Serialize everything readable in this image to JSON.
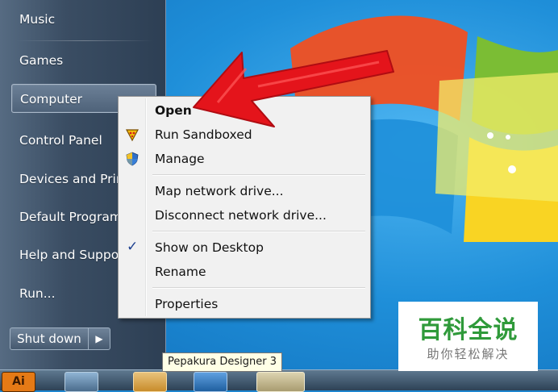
{
  "start_menu": {
    "items": [
      {
        "label": "Music"
      },
      {
        "label": "Games"
      },
      {
        "label": "Computer"
      },
      {
        "label": "Control Panel"
      },
      {
        "label": "Devices and Printers"
      },
      {
        "label": "Default Programs"
      },
      {
        "label": "Help and Support"
      },
      {
        "label": "Run..."
      }
    ],
    "shutdown_label": "Shut down",
    "shutdown_arrow": "▶"
  },
  "context_menu": {
    "items": [
      {
        "label": "Open",
        "bold": true
      },
      {
        "label": "Run Sandboxed",
        "icon": "sandboxie-icon"
      },
      {
        "label": "Manage",
        "icon": "uac-shield-icon"
      },
      {
        "label": "Map network drive..."
      },
      {
        "label": "Disconnect network drive..."
      },
      {
        "label": "Show on Desktop",
        "checked": true
      },
      {
        "label": "Rename"
      },
      {
        "label": "Properties"
      }
    ],
    "check_glyph": "✓"
  },
  "tooltip": {
    "text": "Pepakura Designer 3"
  },
  "taskbar": {
    "ai_label": "Ai"
  },
  "watermark": {
    "title": "百科全说",
    "subtitle": "助你轻松解决"
  },
  "colors": {
    "arrow": "#e4141b",
    "watermark_green": "#2f9a3a"
  }
}
